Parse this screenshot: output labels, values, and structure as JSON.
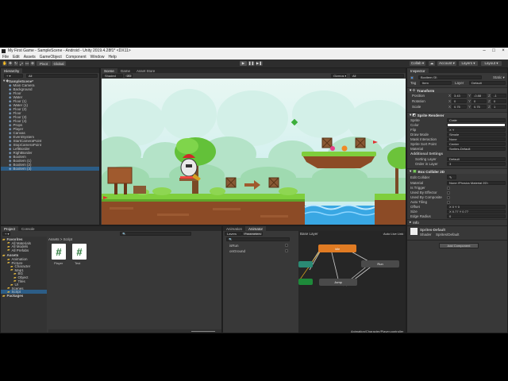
{
  "window": {
    "title": "My First Game - SampleScene - Android - Unity 2019.4.28f1* <DX11>"
  },
  "menu": [
    "File",
    "Edit",
    "Assets",
    "GameObject",
    "Component",
    "Window",
    "Help"
  ],
  "toolbar": {
    "pivot": "Pivot",
    "global": "Global",
    "collab": "Collab ▾",
    "account": "Account ▾",
    "layers": "Layers ▾",
    "layout": "Layout ▾"
  },
  "hierarchy": {
    "tab": "Hierarchy",
    "search_placeholder": "All",
    "scene": "SampleScene*",
    "items": [
      "Main Camera",
      "Background",
      "Floor",
      "Water",
      "Floor (1)",
      "Water (1)",
      "Floor (2)",
      "Floor",
      "Floor (3)",
      "Floor (4)",
      "Props",
      "Player",
      "Canvas",
      "EventSystem",
      "StartCameraPoint",
      "StopCameraPoint",
      "LeftBorder",
      "RightBorder",
      "Boxitem",
      "Boxitem (1)",
      "Boxitem (2)",
      "Boxitem (3)"
    ],
    "selected_index": 21
  },
  "scene_view": {
    "tabs": [
      "Scene",
      "Game",
      "Asset Store"
    ],
    "shading": "Shaded",
    "mode": "2D",
    "gizmos": "Gizmos ▾",
    "search": "All"
  },
  "project": {
    "tabs": [
      "Project",
      "Console"
    ],
    "favorites": {
      "label": "Favorites",
      "items": [
        "All Materials",
        "All Models",
        "All Prefabs"
      ]
    },
    "assets": {
      "label": "Assets",
      "items": [
        "Animation",
        "Picture",
        "Character",
        "Map1",
        "BG",
        "Object",
        "Tiles",
        "UI",
        "Scenes",
        "Script"
      ]
    },
    "packages": "Packages",
    "breadcrumb": "Assets > Script",
    "files": [
      "Player",
      "Test"
    ],
    "count": "17"
  },
  "animator": {
    "tabs": [
      "Animation",
      "Animator"
    ],
    "subtabs": [
      "Layers",
      "Parameters"
    ],
    "layer": "Base Layer",
    "auto_live_link": "Auto Live Link",
    "params": [
      "isRun",
      "onGround"
    ],
    "footer": "Animation/Character/Player.controller"
  },
  "inspector": {
    "tabs": [
      "Inspector"
    ],
    "object_name": "Boxitem (3)",
    "static": "Static ▾",
    "tag": "Item",
    "layer": "Default",
    "transform": {
      "title": "Transform",
      "position": {
        "label": "Position",
        "x": "3.43",
        "y": "-0.88",
        "z": "-1"
      },
      "rotation": {
        "label": "Rotation",
        "x": "0",
        "y": "0",
        "z": "0"
      },
      "scale": {
        "label": "Scale",
        "x": "0.75",
        "y": "0.75",
        "z": "1"
      }
    },
    "sprite_renderer": {
      "title": "Sprite Renderer",
      "rows": [
        {
          "label": "Sprite",
          "value": "Crate"
        },
        {
          "label": "Color",
          "value": ""
        },
        {
          "label": "Flip",
          "value": "X  Y"
        },
        {
          "label": "Draw Mode",
          "value": "Simple"
        },
        {
          "label": "Mask Interaction",
          "value": "None"
        },
        {
          "label": "Sprite Sort Point",
          "value": "Center"
        },
        {
          "label": "Material",
          "value": "Sprites-Default"
        }
      ],
      "additional": "Additional Settings",
      "sorting_layer": {
        "label": "Sorting Layer",
        "value": "Default"
      },
      "order": {
        "label": "Order in Layer",
        "value": "3"
      }
    },
    "box_collider": {
      "title": "Box Collider 2D",
      "edit": "Edit Collider",
      "rows": [
        {
          "label": "Material",
          "value": "None (Physics Material 2D)"
        },
        {
          "label": "Is Trigger",
          "value": ""
        },
        {
          "label": "Used By Effector",
          "value": ""
        },
        {
          "label": "Used By Composite",
          "value": ""
        },
        {
          "label": "Auto Tiling",
          "value": ""
        },
        {
          "label": "Offset",
          "value": "X 0    Y 0"
        },
        {
          "label": "Size",
          "value": "X 0.77    Y 0.77"
        },
        {
          "label": "Edge Radius",
          "value": "0"
        }
      ],
      "info": "Info"
    },
    "material": {
      "name": "Sprites-Default",
      "shader_label": "Shader",
      "shader": "Sprites/Default"
    },
    "add_component": "Add Component"
  },
  "colors": {
    "bg": "#383838",
    "selection": "#2c5d87",
    "accent_orange": "#e07b23",
    "state_green": "#1e8a3a",
    "state_teal": "#2b8a74"
  }
}
